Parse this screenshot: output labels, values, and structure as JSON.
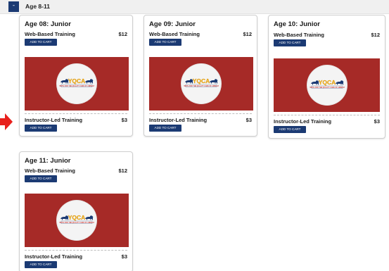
{
  "section": {
    "toggle_symbol": "-",
    "title": "Age 8-11"
  },
  "arrow_color": "#e8201c",
  "cards": [
    {
      "title": "Age 08: Junior",
      "web": {
        "label": "Web-Based Training",
        "price": "$12",
        "button": "ADD TO CART"
      },
      "instructor": {
        "label": "Instructor-Led Training",
        "price": "$3",
        "button": "ADD TO CART"
      }
    },
    {
      "title": "Age 09: Junior",
      "web": {
        "label": "Web-Based Training",
        "price": "$12",
        "button": "ADD TO CART"
      },
      "instructor": {
        "label": "Instructor-Led Training",
        "price": "$3",
        "button": "ADD TO CART"
      }
    },
    {
      "title": "Age 10: Junior",
      "web": {
        "label": "Web-Based Training",
        "price": "$12",
        "button": "ADD TO CART"
      },
      "instructor": {
        "label": "Instructor-Led Training",
        "price": "$3",
        "button": "ADD TO CART"
      }
    },
    {
      "title": "Age 11: Junior",
      "web": {
        "label": "Web-Based Training",
        "price": "$12",
        "button": "ADD TO CART"
      },
      "instructor": {
        "label": "Instructor-Led Training",
        "price": "$3",
        "button": "ADD TO CART"
      }
    }
  ],
  "logo": {
    "name": "YQCA logo",
    "text": "YQCA",
    "tagline": "YOUTH FOR THE QUALITY CARE OF ANIMALS"
  },
  "colors": {
    "brand_navy": "#1b3a73",
    "banner_red": "#a62a27",
    "logo_gold": "#f2b31b",
    "logo_red": "#c8302a"
  }
}
